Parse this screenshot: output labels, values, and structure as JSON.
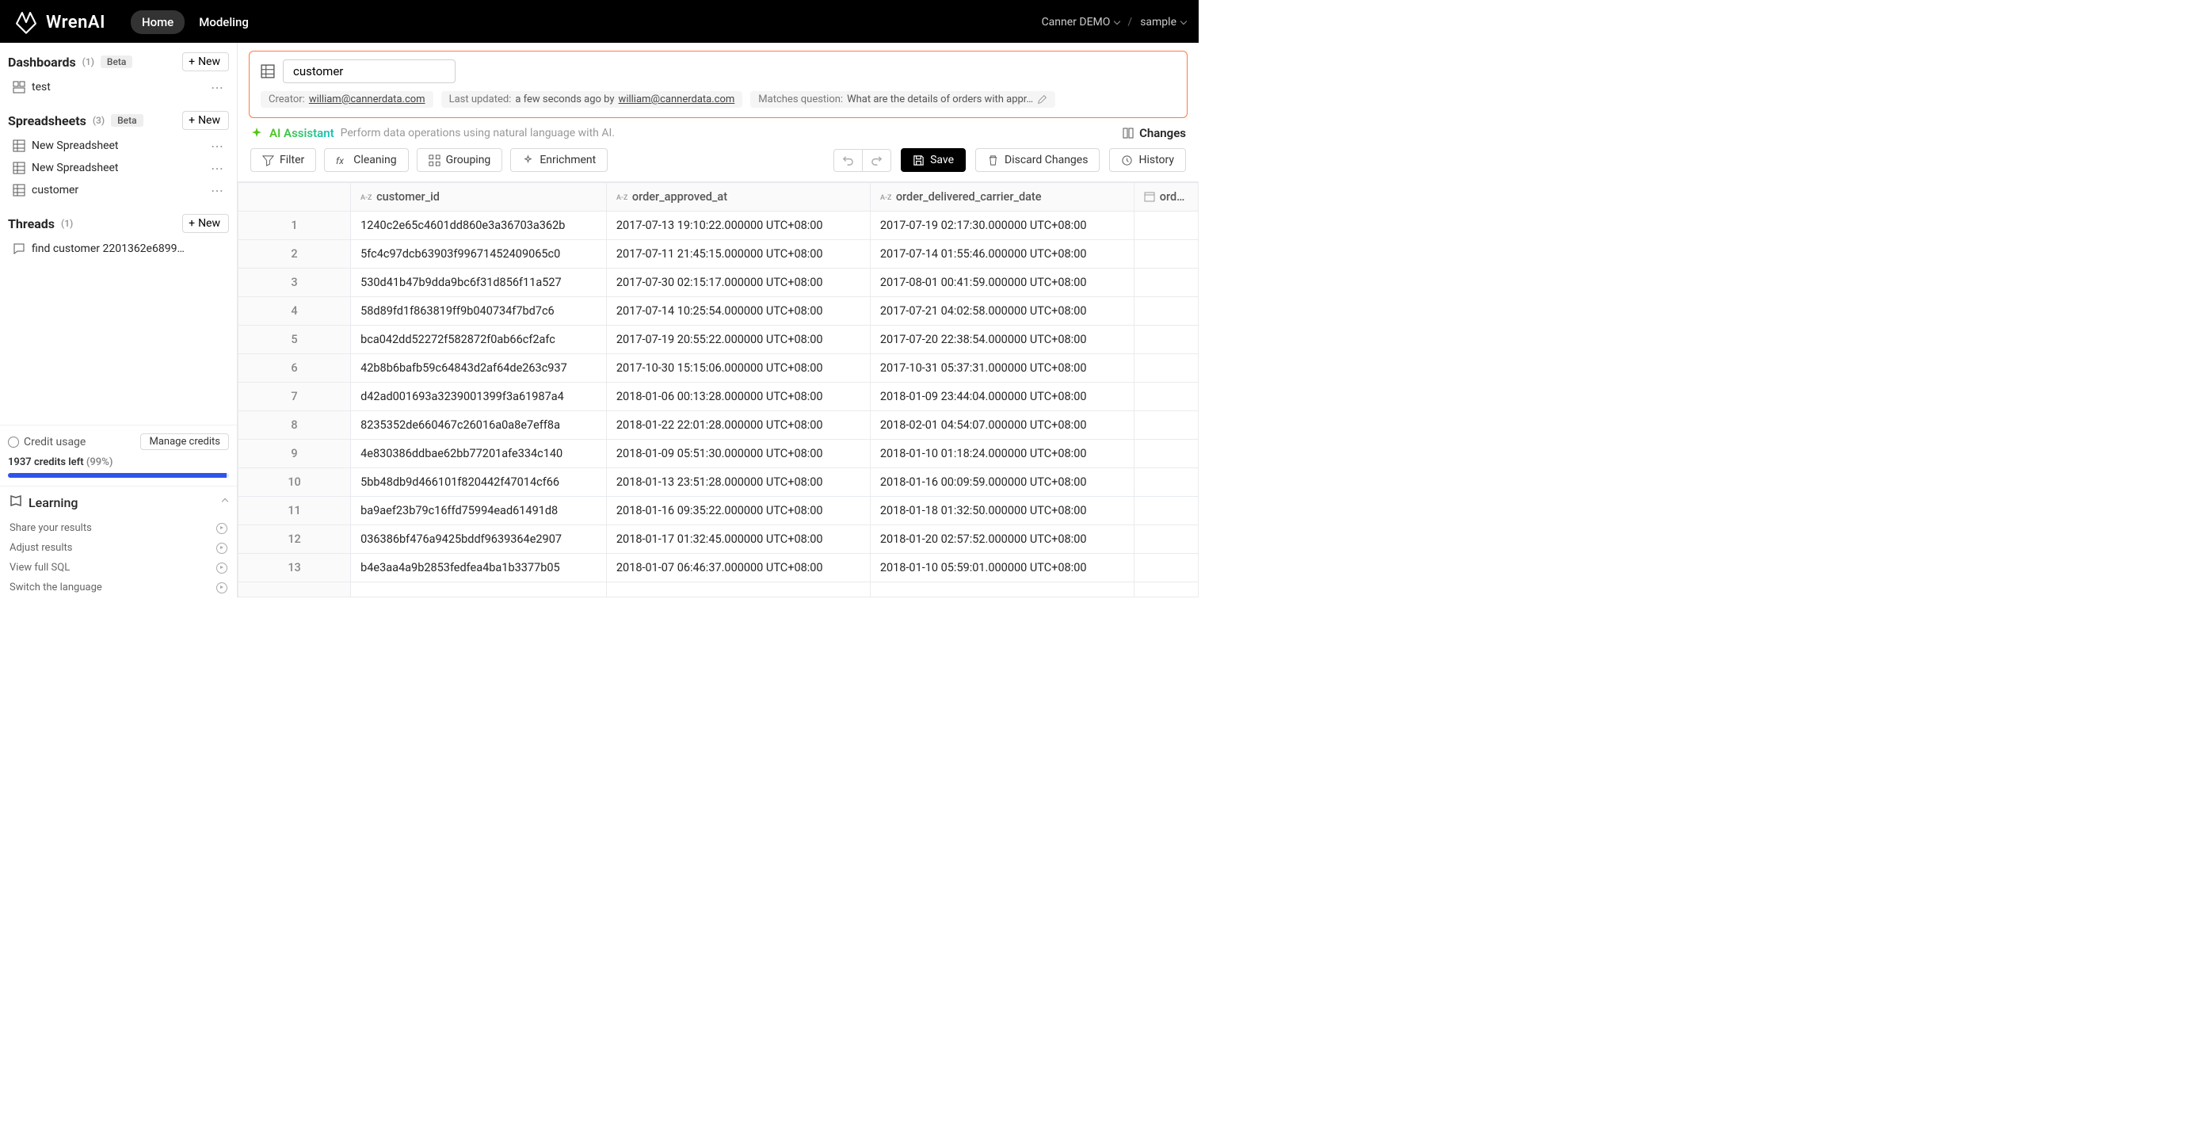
{
  "app": {
    "name": "WrenAI"
  },
  "nav": {
    "tabs": [
      "Home",
      "Modeling"
    ],
    "active": 0
  },
  "breadcrumb": {
    "project": "Canner DEMO",
    "dataset": "sample"
  },
  "sidebar": {
    "dashboards": {
      "title": "Dashboards",
      "count": "(1)",
      "badge": "Beta",
      "new": "New",
      "items": [
        {
          "label": "test"
        }
      ]
    },
    "spreadsheets": {
      "title": "Spreadsheets",
      "count": "(3)",
      "badge": "Beta",
      "new": "New",
      "items": [
        {
          "label": "New Spreadsheet"
        },
        {
          "label": "New Spreadsheet"
        },
        {
          "label": "customer"
        }
      ]
    },
    "threads": {
      "title": "Threads",
      "count": "(1)",
      "new": "New",
      "items": [
        {
          "label": "find customer 2201362e6899…"
        }
      ]
    },
    "credit": {
      "title": "Credit usage",
      "manage": "Manage credits",
      "left_num": "1937",
      "left_text": " credits left ",
      "pct": "(99%)"
    },
    "learning": {
      "title": "Learning",
      "items": [
        "Share your results",
        "Adjust results",
        "View full SQL",
        "Switch the language"
      ]
    }
  },
  "doc": {
    "name": "customer",
    "meta": {
      "creator_label": "Creator:",
      "creator_email": "william@cannerdata.com",
      "updated_label": "Last updated:",
      "updated_ago": "a few seconds ago by ",
      "updated_email": "william@cannerdata.com",
      "question_label": "Matches question:",
      "question_text": "What are the details of orders with appr…"
    }
  },
  "toolbar": {
    "ai_label": "AI Assistant",
    "ai_hint": "Perform data operations using natural language with AI.",
    "changes_label": "Changes",
    "filter": "Filter",
    "cleaning": "Cleaning",
    "grouping": "Grouping",
    "enrichment": "Enrichment",
    "save": "Save",
    "discard": "Discard Changes",
    "history": "History"
  },
  "grid": {
    "columns": [
      {
        "key": "customer_id",
        "label": "customer_id",
        "type": "text"
      },
      {
        "key": "order_approved_at",
        "label": "order_approved_at",
        "type": "text"
      },
      {
        "key": "order_delivered_carrier_date",
        "label": "order_delivered_carrier_date",
        "type": "text"
      },
      {
        "key": "order_",
        "label": "order_",
        "type": "date"
      }
    ],
    "rows": [
      {
        "n": "1",
        "customer_id": "1240c2e65c4601dd860e3a36703a362b",
        "order_approved_at": "2017-07-13 19:10:22.000000 UTC+08:00",
        "order_delivered_carrier_date": "2017-07-19 02:17:30.000000 UTC+08:00"
      },
      {
        "n": "2",
        "customer_id": "5fc4c97dcb63903f99671452409065c0",
        "order_approved_at": "2017-07-11 21:45:15.000000 UTC+08:00",
        "order_delivered_carrier_date": "2017-07-14 01:55:46.000000 UTC+08:00"
      },
      {
        "n": "3",
        "customer_id": "530d41b47b9dda9bc6f31d856f11a527",
        "order_approved_at": "2017-07-30 02:15:17.000000 UTC+08:00",
        "order_delivered_carrier_date": "2017-08-01 00:41:59.000000 UTC+08:00"
      },
      {
        "n": "4",
        "customer_id": "58d89fd1f863819ff9b040734f7bd7c6",
        "order_approved_at": "2017-07-14 10:25:54.000000 UTC+08:00",
        "order_delivered_carrier_date": "2017-07-21 04:02:58.000000 UTC+08:00"
      },
      {
        "n": "5",
        "customer_id": "bca042dd52272f582872f0ab66cf2afc",
        "order_approved_at": "2017-07-19 20:55:22.000000 UTC+08:00",
        "order_delivered_carrier_date": "2017-07-20 22:38:54.000000 UTC+08:00"
      },
      {
        "n": "6",
        "customer_id": "42b8b6bafb59c64843d2af64de263c937",
        "order_approved_at": "2017-10-30 15:15:06.000000 UTC+08:00",
        "order_delivered_carrier_date": "2017-10-31 05:37:31.000000 UTC+08:00"
      },
      {
        "n": "7",
        "customer_id": "d42ad001693a3239001399f3a61987a4",
        "order_approved_at": "2018-01-06 00:13:28.000000 UTC+08:00",
        "order_delivered_carrier_date": "2018-01-09 23:44:04.000000 UTC+08:00"
      },
      {
        "n": "8",
        "customer_id": "8235352de660467c26016a0a8e7eff8a",
        "order_approved_at": "2018-01-22 22:01:28.000000 UTC+08:00",
        "order_delivered_carrier_date": "2018-02-01 04:54:07.000000 UTC+08:00"
      },
      {
        "n": "9",
        "customer_id": "4e830386ddbae62bb77201afe334c140",
        "order_approved_at": "2018-01-09 05:51:30.000000 UTC+08:00",
        "order_delivered_carrier_date": "2018-01-10 01:18:24.000000 UTC+08:00"
      },
      {
        "n": "10",
        "customer_id": "5bb48db9d466101f820442f47014cf66",
        "order_approved_at": "2018-01-13 23:51:28.000000 UTC+08:00",
        "order_delivered_carrier_date": "2018-01-16 00:09:59.000000 UTC+08:00"
      },
      {
        "n": "11",
        "customer_id": "ba9aef23b79c16ffd75994ead61491d8",
        "order_approved_at": "2018-01-16 09:35:22.000000 UTC+08:00",
        "order_delivered_carrier_date": "2018-01-18 01:32:50.000000 UTC+08:00"
      },
      {
        "n": "12",
        "customer_id": "036386bf476a9425bddf9639364e2907",
        "order_approved_at": "2018-01-17 01:32:45.000000 UTC+08:00",
        "order_delivered_carrier_date": "2018-01-20 02:57:52.000000 UTC+08:00"
      },
      {
        "n": "13",
        "customer_id": "b4e3aa4a9b2853fedfea4ba1b3377b05",
        "order_approved_at": "2018-01-07 06:46:37.000000 UTC+08:00",
        "order_delivered_carrier_date": "2018-01-10 05:59:01.000000 UTC+08:00"
      }
    ]
  }
}
